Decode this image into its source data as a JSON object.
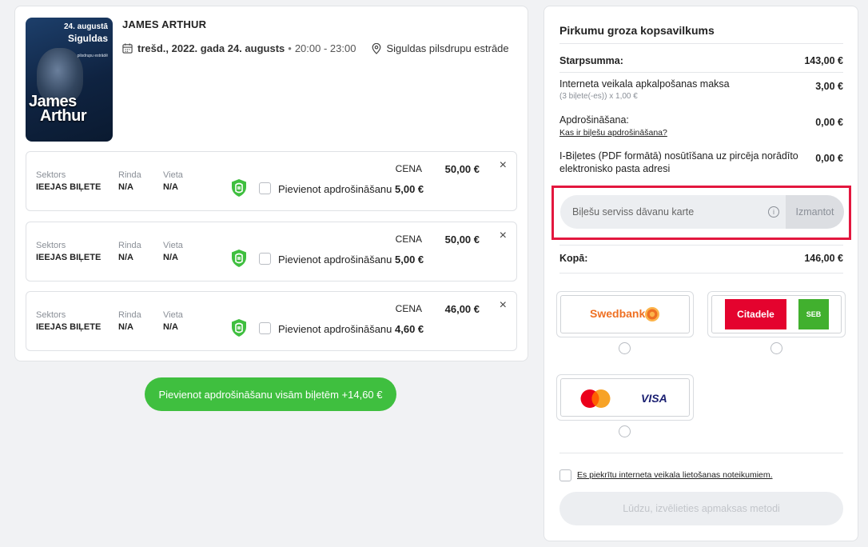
{
  "event": {
    "poster": {
      "date": "24. augustā",
      "city_line1": "Siguldas",
      "sub": "pilsdrupu estrādē",
      "name_line1": "James",
      "name_line2": "Arthur"
    },
    "title": "JAMES ARTHUR",
    "date": "trešd., 2022. gada 24. augusts",
    "dot": "•",
    "time": "20:00 - 23:00",
    "venue": "Siguldas pilsdrupu estrāde"
  },
  "tickets": [
    {
      "sector_label": "Sektors",
      "sector": "IEEJAS BIĻETE",
      "row_label": "Rinda",
      "row": "N/A",
      "seat_label": "Vieta",
      "seat": "N/A",
      "cena_label": "CENA",
      "price": "50,00 €",
      "insurance_label": "Pievienot apdrošināšanu",
      "insurance_price": "5,00 €"
    },
    {
      "sector_label": "Sektors",
      "sector": "IEEJAS BIĻETE",
      "row_label": "Rinda",
      "row": "N/A",
      "seat_label": "Vieta",
      "seat": "N/A",
      "cena_label": "CENA",
      "price": "50,00 €",
      "insurance_label": "Pievienot apdrošināšanu",
      "insurance_price": "5,00 €"
    },
    {
      "sector_label": "Sektors",
      "sector": "IEEJAS BIĻETE",
      "row_label": "Rinda",
      "row": "N/A",
      "seat_label": "Vieta",
      "seat": "N/A",
      "cena_label": "CENA",
      "price": "46,00 €",
      "insurance_label": "Pievienot apdrošināšanu",
      "insurance_price": "4,60 €"
    }
  ],
  "insure_all_button": "Pievienot apdrošināšanu visām biļetēm +14,60 €",
  "summary": {
    "title": "Pirkumu groza kopsavilkums",
    "subtotal_label": "Starpsumma:",
    "subtotal": "143,00 €",
    "fee_label": "Interneta veikala apkalpošanas maksa",
    "fee_sub": "(3 biļete(-es)) x 1,00 €",
    "fee": "3,00 €",
    "insurance_label": "Apdrošināšana:",
    "insurance_link": "Kas ir biļešu apdrošināšana?",
    "insurance": "0,00 €",
    "pdf_label": "I-Biļetes (PDF formātā) nosūtīšana uz pircēja norādīto elektronisko pasta adresi",
    "pdf": "0,00 €",
    "gift_placeholder": "Biļešu serviss dāvanu karte",
    "gift_info": "i",
    "gift_button": "Izmantot",
    "total_label": "Kopā:",
    "total": "146,00 €"
  },
  "payment": {
    "swedbank": "Swedbank",
    "citadele": "Citadele",
    "seb": "SEB",
    "visa": "VISA"
  },
  "terms": "Es piekrītu interneta veikala lietošanas noteikumiem.",
  "pay_button": "Lūdzu, izvēlieties apmaksas metodi",
  "colors": {
    "accent_green": "#3fbf3f",
    "highlight_red": "#e3173e",
    "citadele_red": "#e4032e",
    "seb_green": "#41b02e",
    "swedbank_orange": "#ee7023"
  }
}
